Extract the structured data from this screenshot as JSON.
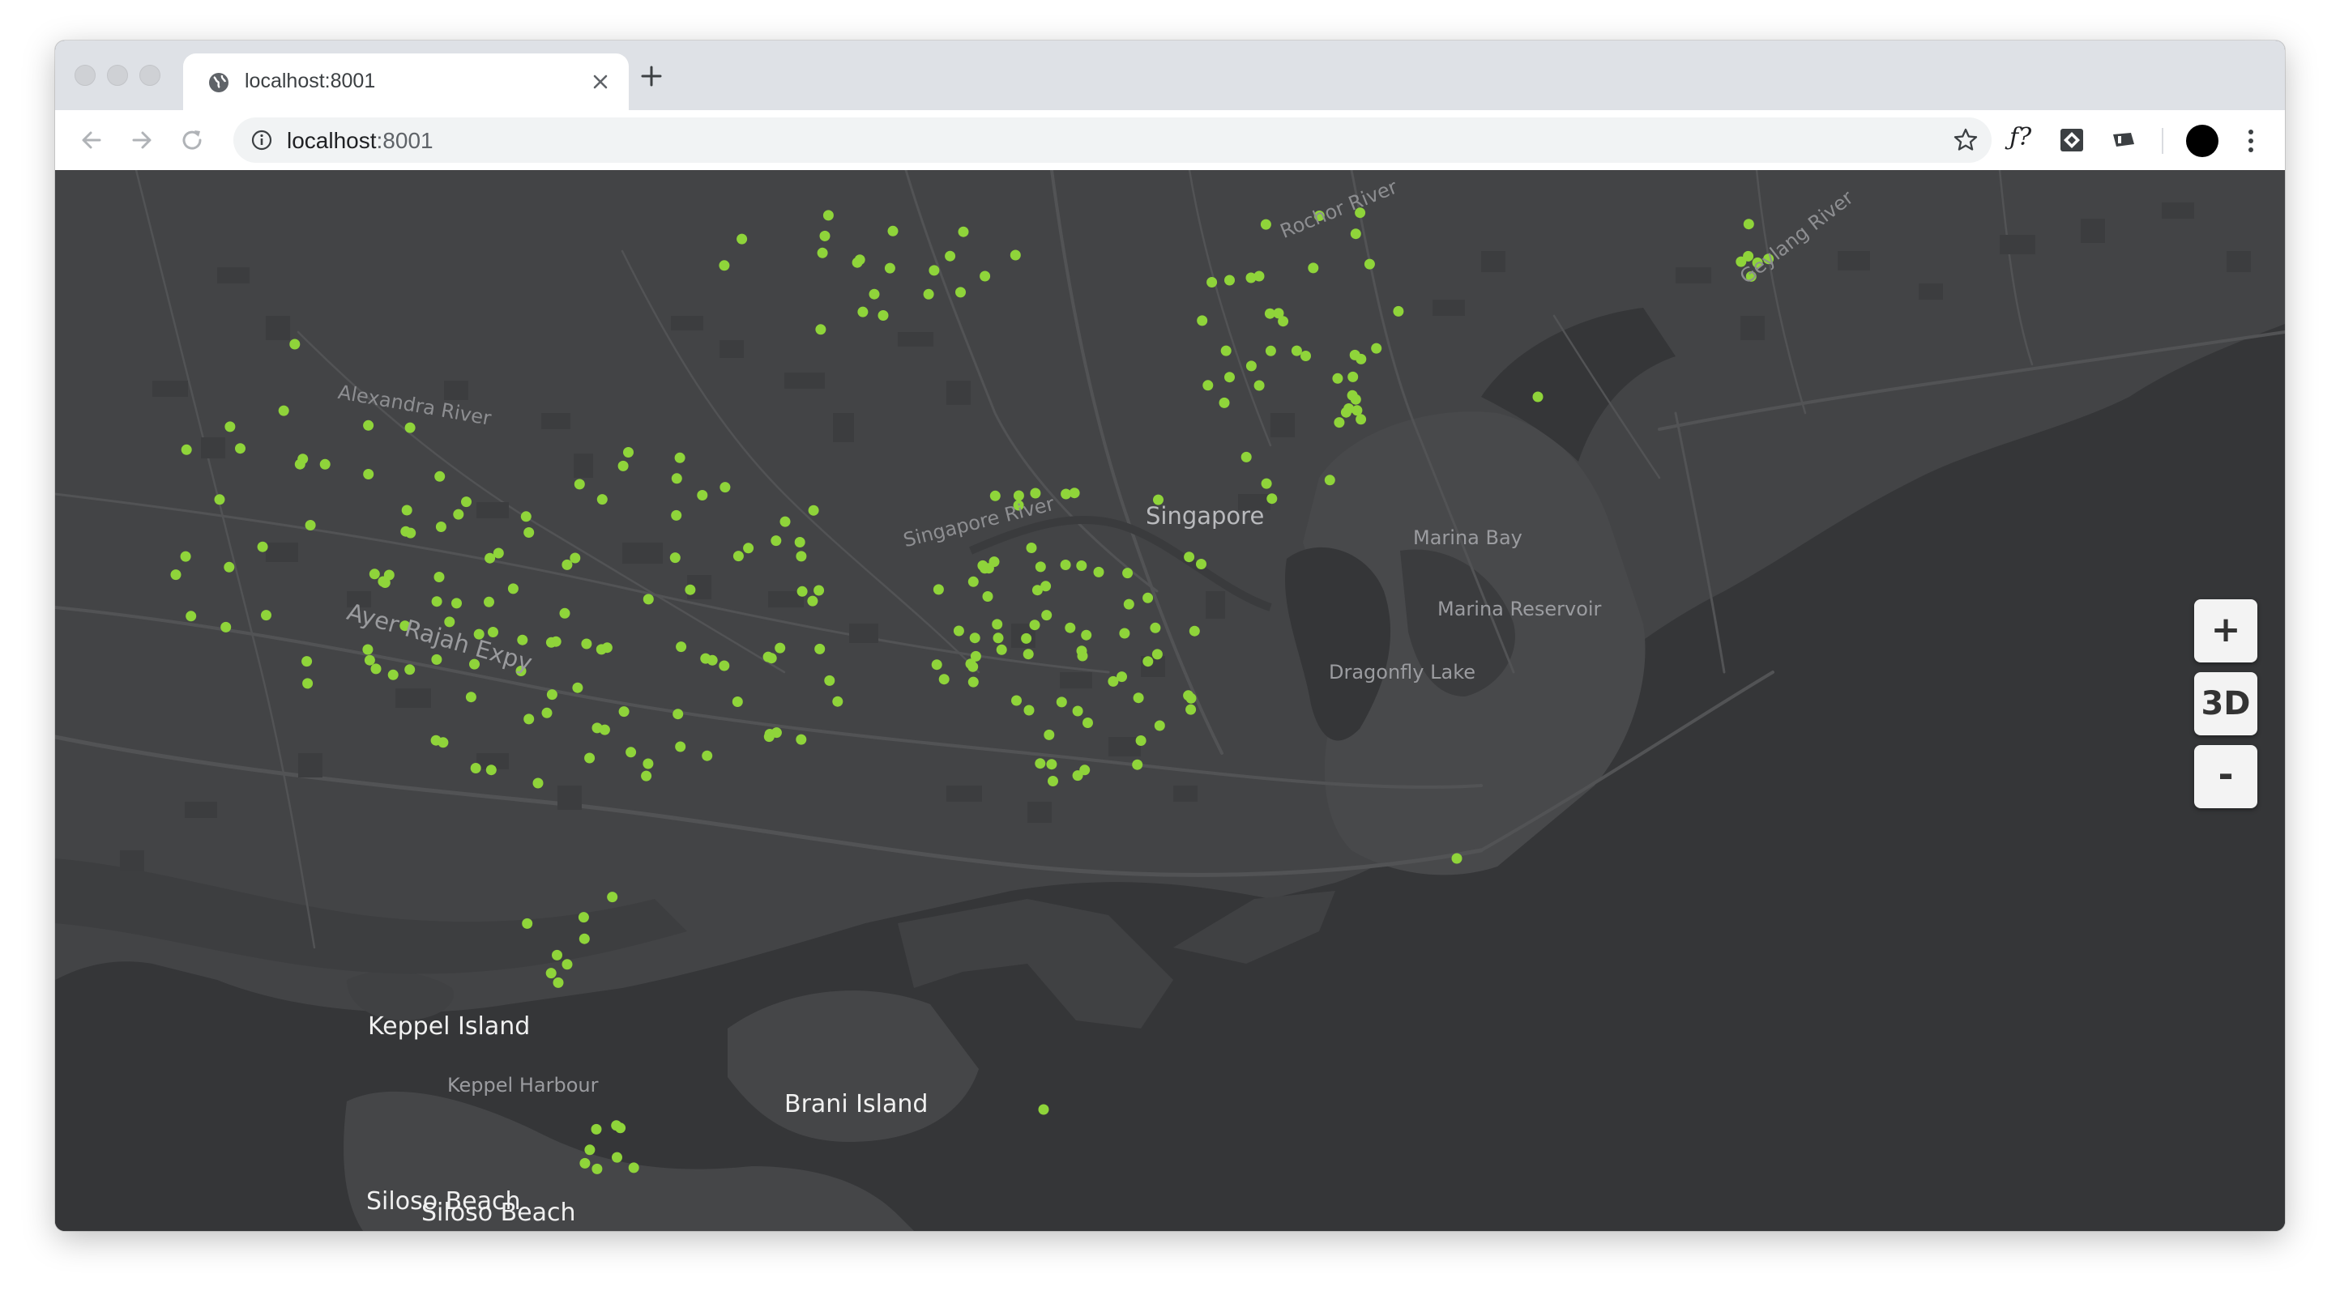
{
  "browser": {
    "tab_title": "localhost:8001",
    "url_host": "localhost",
    "url_port": ":8001",
    "extensions": [
      {
        "name": "function-extension",
        "glyph": "ƒ?"
      },
      {
        "name": "code-extension",
        "glyph": "◈"
      },
      {
        "name": "ticket-extension",
        "glyph": "▰"
      }
    ]
  },
  "map": {
    "labels": {
      "city": "Singapore",
      "marina_bay": "Marina Bay",
      "marina_reservoir": "Marina Reservoir",
      "dragonfly_lake": "Dragonfly Lake",
      "keppel_island": "Keppel Island",
      "keppel_harbour": "Keppel Harbour",
      "brani_island": "Brani Island",
      "siloso_beach_1": "Siloso Beach",
      "siloso_beach_2": "Siloso Beach",
      "alexandra_river": "Alexandra River",
      "singapore_river": "Singapore River",
      "ayer_rajah": "Ayer Rajah Expy",
      "rochor_river": "Rochor River",
      "geylang_river": "Geylang River"
    },
    "point_color": "#8fd43a",
    "controls": {
      "zoom_in": "+",
      "toggle_3d": "3D",
      "zoom_out": "-"
    }
  }
}
